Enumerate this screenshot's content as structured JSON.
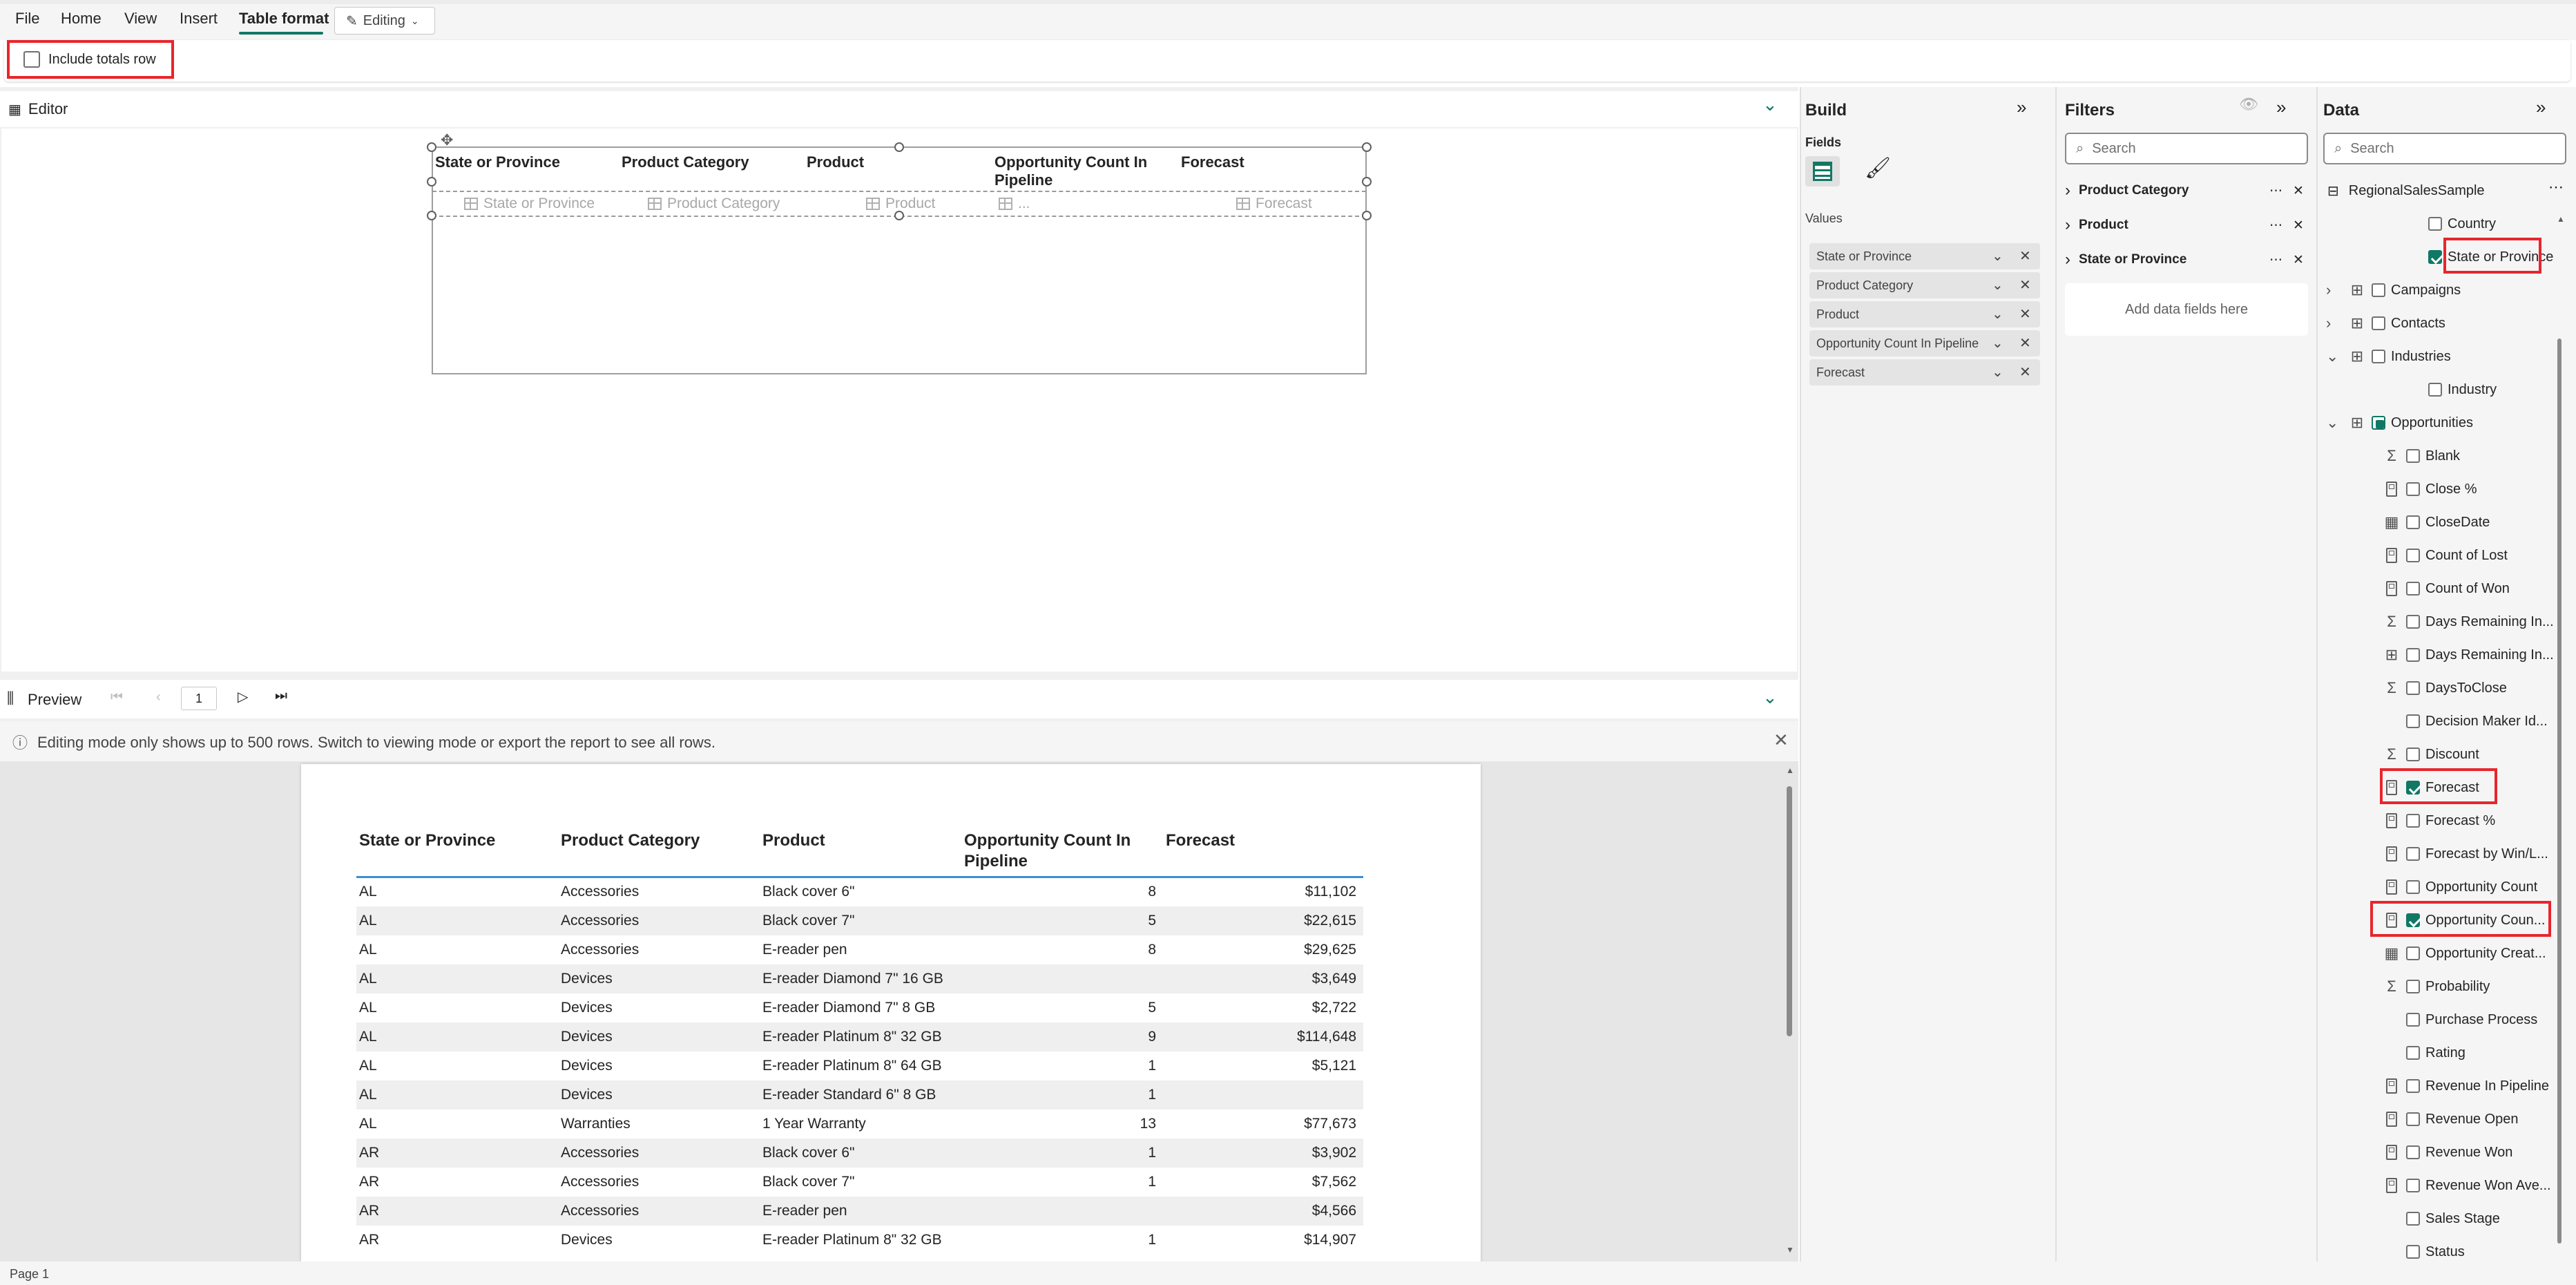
{
  "menu": {
    "file": "File",
    "home": "Home",
    "view": "View",
    "insert": "Insert",
    "table_format": "Table format",
    "editing": "Editing"
  },
  "ribbon": {
    "include_totals_row": "Include totals row",
    "include_totals_checked": false
  },
  "editor": {
    "title": "Editor",
    "columns": [
      "State or Province",
      "Product Category",
      "Product",
      "Opportunity Count In Pipeline",
      "Forecast"
    ],
    "field_placeholders": [
      "State or Province",
      "Product Category",
      "Product",
      "...",
      "Forecast"
    ]
  },
  "preview": {
    "title": "Preview",
    "page_number": "1",
    "notice": "Editing mode only shows up to 500 rows. Switch to viewing mode or export the report to see all rows.",
    "headers": [
      "State or Province",
      "Product Category",
      "Product",
      "Opportunity Count In Pipeline",
      "Forecast"
    ],
    "rows": [
      [
        "AL",
        "Accessories",
        "Black cover 6\"",
        "8",
        "$11,102"
      ],
      [
        "AL",
        "Accessories",
        "Black cover 7\"",
        "5",
        "$22,615"
      ],
      [
        "AL",
        "Accessories",
        "E-reader pen",
        "8",
        "$29,625"
      ],
      [
        "AL",
        "Devices",
        "E-reader Diamond 7\" 16 GB",
        "",
        "$3,649"
      ],
      [
        "AL",
        "Devices",
        "E-reader Diamond 7\" 8 GB",
        "5",
        "$2,722"
      ],
      [
        "AL",
        "Devices",
        "E-reader Platinum 8\" 32 GB",
        "9",
        "$114,648"
      ],
      [
        "AL",
        "Devices",
        "E-reader Platinum 8\" 64 GB",
        "1",
        "$5,121"
      ],
      [
        "AL",
        "Devices",
        "E-reader Standard 6\" 8 GB",
        "1",
        ""
      ],
      [
        "AL",
        "Warranties",
        "1 Year Warranty",
        "13",
        "$77,673"
      ],
      [
        "AR",
        "Accessories",
        "Black cover 6\"",
        "1",
        "$3,902"
      ],
      [
        "AR",
        "Accessories",
        "Black cover 7\"",
        "1",
        "$7,562"
      ],
      [
        "AR",
        "Accessories",
        "E-reader pen",
        "",
        "$4,566"
      ],
      [
        "AR",
        "Devices",
        "E-reader Platinum 8\" 32 GB",
        "1",
        "$14,907"
      ]
    ]
  },
  "status": {
    "page": "Page 1"
  },
  "build": {
    "title": "Build",
    "fields_label": "Fields",
    "values_label": "Values",
    "values": [
      "State or Province",
      "Product Category",
      "Product",
      "Opportunity Count In Pipeline",
      "Forecast"
    ]
  },
  "filters": {
    "title": "Filters",
    "search_placeholder": "Search",
    "items": [
      "Product Category",
      "Product",
      "State or Province"
    ],
    "add_fields": "Add data fields here"
  },
  "data": {
    "title": "Data",
    "search_placeholder": "Search",
    "model": "RegionalSalesSample",
    "tree": [
      {
        "label": "Country",
        "indent": 2,
        "icon": "none",
        "check": "off"
      },
      {
        "label": "State or Province",
        "indent": 2,
        "icon": "none",
        "check": "on",
        "highlight": true
      },
      {
        "label": "Campaigns",
        "indent": 0,
        "icon": "table",
        "check": "off",
        "expander": "right"
      },
      {
        "label": "Contacts",
        "indent": 0,
        "icon": "table",
        "check": "off",
        "expander": "right"
      },
      {
        "label": "Industries",
        "indent": 0,
        "icon": "table",
        "check": "off",
        "expander": "down"
      },
      {
        "label": "Industry",
        "indent": 2,
        "icon": "none",
        "check": "off"
      },
      {
        "label": "Opportunities",
        "indent": 0,
        "icon": "table",
        "check": "part",
        "expander": "down"
      },
      {
        "label": "Blank",
        "indent": 1,
        "icon": "sigma",
        "check": "off"
      },
      {
        "label": "Close %",
        "indent": 1,
        "icon": "calc",
        "check": "off"
      },
      {
        "label": "CloseDate",
        "indent": 1,
        "icon": "calendar",
        "check": "off"
      },
      {
        "label": "Count of Lost",
        "indent": 1,
        "icon": "calc",
        "check": "off"
      },
      {
        "label": "Count of Won",
        "indent": 1,
        "icon": "calc",
        "check": "off"
      },
      {
        "label": "Days Remaining In...",
        "indent": 1,
        "icon": "sigma",
        "check": "off"
      },
      {
        "label": "Days Remaining In...",
        "indent": 1,
        "icon": "hier",
        "check": "off"
      },
      {
        "label": "DaysToClose",
        "indent": 1,
        "icon": "sigma",
        "check": "off"
      },
      {
        "label": "Decision Maker Id...",
        "indent": 1,
        "icon": "none",
        "check": "off"
      },
      {
        "label": "Discount",
        "indent": 1,
        "icon": "sigma",
        "check": "off"
      },
      {
        "label": "Forecast",
        "indent": 1,
        "icon": "calc",
        "check": "on",
        "highlight": true
      },
      {
        "label": "Forecast %",
        "indent": 1,
        "icon": "calc",
        "check": "off"
      },
      {
        "label": "Forecast by Win/L...",
        "indent": 1,
        "icon": "calc",
        "check": "off"
      },
      {
        "label": "Opportunity Count",
        "indent": 1,
        "icon": "calc",
        "check": "off"
      },
      {
        "label": "Opportunity Coun...",
        "indent": 1,
        "icon": "calc",
        "check": "on",
        "highlight": true
      },
      {
        "label": "Opportunity Creat...",
        "indent": 1,
        "icon": "calendar",
        "check": "off"
      },
      {
        "label": "Probability",
        "indent": 1,
        "icon": "sigma",
        "check": "off"
      },
      {
        "label": "Purchase Process",
        "indent": 1,
        "icon": "none",
        "check": "off"
      },
      {
        "label": "Rating",
        "indent": 1,
        "icon": "none",
        "check": "off"
      },
      {
        "label": "Revenue In Pipeline",
        "indent": 1,
        "icon": "calc",
        "check": "off"
      },
      {
        "label": "Revenue Open",
        "indent": 1,
        "icon": "calc",
        "check": "off"
      },
      {
        "label": "Revenue Won",
        "indent": 1,
        "icon": "calc",
        "check": "off"
      },
      {
        "label": "Revenue Won Ave...",
        "indent": 1,
        "icon": "calc",
        "check": "off"
      },
      {
        "label": "Sales Stage",
        "indent": 1,
        "icon": "none",
        "check": "off"
      },
      {
        "label": "Status",
        "indent": 1,
        "icon": "none",
        "check": "off"
      }
    ]
  }
}
